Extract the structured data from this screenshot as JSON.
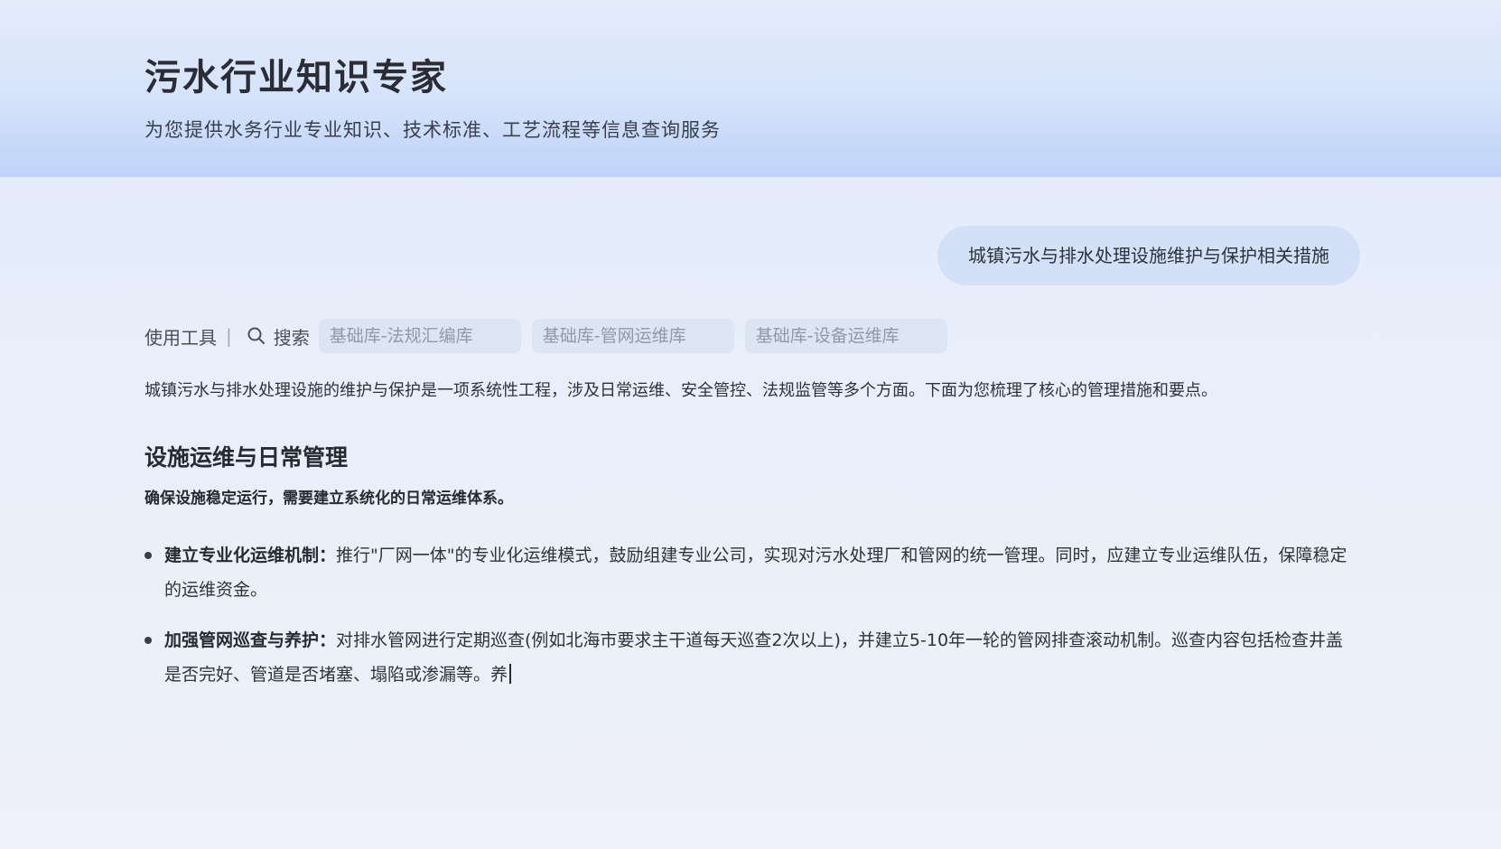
{
  "header": {
    "title": "污水行业知识专家",
    "subtitle": "为您提供水务行业专业知识、技术标准、工艺流程等信息查询服务"
  },
  "chat": {
    "user_message": "城镇污水与排水处理设施维护与保护相关措施",
    "tools": {
      "label": "使用工具",
      "divider": "|",
      "search_label": "搜索",
      "knowledge_bases": [
        "基础库-法规汇编库",
        "基础库-管网运维库",
        "基础库-设备运维库"
      ]
    },
    "answer": {
      "intro": "城镇污水与排水处理设施的维护与保护是一项系统性工程，涉及日常运维、安全管控、法规监管等多个方面。下面为您梳理了核心的管理措施和要点。",
      "section_title": "设施运维与日常管理",
      "section_lead": "确保设施稳定运行，需要建立系统化的日常运维体系。",
      "bullets": [
        {
          "term": "建立专业化运维机制：",
          "text": "推行\"厂网一体\"的专业化运维模式，鼓励组建专业公司，实现对污水处理厂和管网的统一管理。同时，应建立专业运维队伍，保障稳定的运维资金。"
        },
        {
          "term": "加强管网巡查与养护：",
          "text": "对排水管网进行定期巡查(例如北海市要求主干道每天巡查2次以上)，并建立5-10年一轮的管网排查滚动机制。巡查内容包括检查井盖是否完好、管道是否堵塞、塌陷或渗漏等。养"
        }
      ]
    }
  },
  "icons": {
    "search": "search-icon"
  },
  "colors": {
    "header_gradient_bottom": "#bed3f8",
    "user_bubble": "#d3e0f8",
    "chip_background": "#dde5f5",
    "chip_text": "#9198a6"
  }
}
